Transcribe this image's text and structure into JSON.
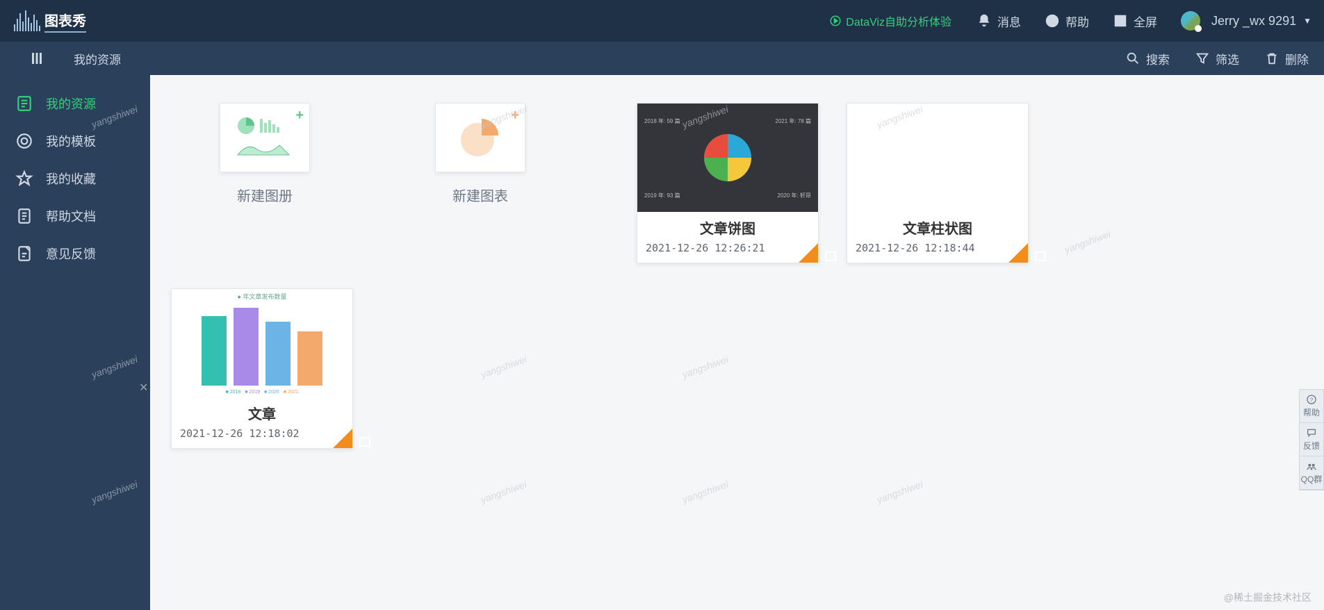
{
  "header": {
    "logo_text": "图表秀",
    "dataviz": "DataViz自助分析体验",
    "message": "消息",
    "help": "帮助",
    "fullscreen": "全屏",
    "username": "Jerry _wx 9291"
  },
  "subbar": {
    "breadcrumb": "我的资源",
    "search": "搜索",
    "filter": "筛选",
    "delete": "删除"
  },
  "sidebar": {
    "items": [
      {
        "label": "我的资源",
        "active": true
      },
      {
        "label": "我的模板",
        "active": false
      },
      {
        "label": "我的收藏",
        "active": false
      },
      {
        "label": "帮助文档",
        "active": false
      },
      {
        "label": "意见反馈",
        "active": false
      }
    ]
  },
  "create": {
    "album": "新建图册",
    "chart": "新建图表"
  },
  "cards": [
    {
      "title": "文章饼图",
      "date": "2021-12-26 12:26:21"
    },
    {
      "title": "文章柱状图",
      "date": "2021-12-26 12:18:44"
    },
    {
      "title": "文章",
      "date": "2021-12-26 12:18:02"
    }
  ],
  "float": {
    "help": "帮助",
    "feedback": "反馈",
    "qq": "QQ群"
  },
  "watermark": "yangshiwei",
  "footer": "@稀土掘金技术社区",
  "pie_labels": {
    "a": "2018 年: 59 篇",
    "b": "2021 年: 78 篇",
    "c": "2019 年: 93 篇",
    "d": "2020 年: 轩昂"
  }
}
